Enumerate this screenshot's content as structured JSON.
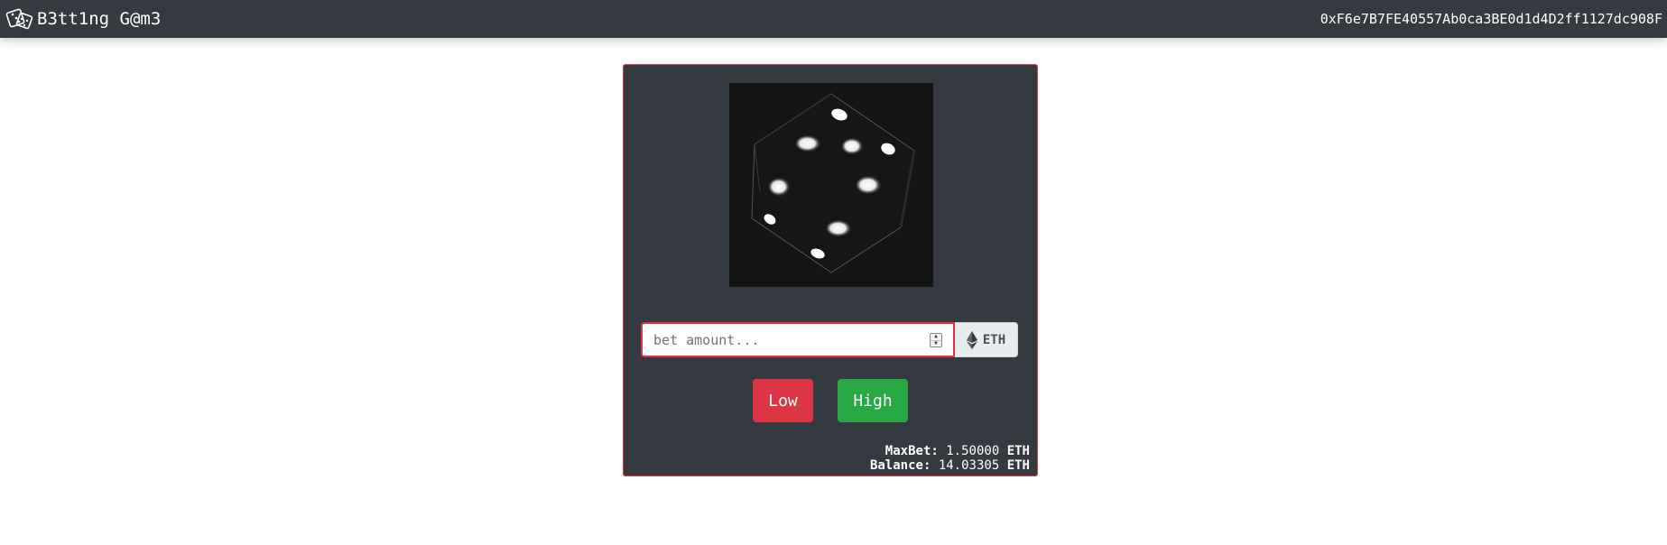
{
  "navbar": {
    "brand_icon": "dice-icon",
    "title": "B3tt1ng G@m3",
    "wallet_address": "0xF6e7B7FE40557Ab0ca3BE0d1d4D2ff1127dc908F"
  },
  "game": {
    "dice_image": "rolling-dice",
    "bet_input": {
      "value": "",
      "placeholder": "bet amount..."
    },
    "currency_icon": "ethereum-icon",
    "currency_label": "ETH",
    "low_label": "Low",
    "high_label": "High",
    "stats": {
      "max_bet_label": "MaxBet:",
      "max_bet_value": "1.50000",
      "max_bet_unit": "ETH",
      "balance_label": "Balance:",
      "balance_value": "14.03305",
      "balance_unit": "ETH"
    }
  },
  "colors": {
    "navbar_bg": "#343a40",
    "card_bg": "#343a40",
    "accent_border": "#dc3545",
    "low_button": "#dc3545",
    "high_button": "#28a745",
    "dice_bg": "#141414"
  }
}
